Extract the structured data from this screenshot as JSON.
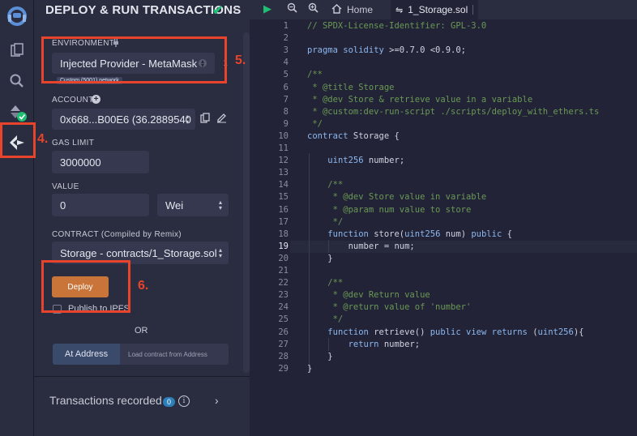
{
  "panel": {
    "title": "DEPLOY & RUN TRANSACTIONS",
    "environment": {
      "label": "ENVIRONMENT",
      "value": "Injected Provider - MetaMask",
      "network_tooltip": "Custom (5001) network"
    },
    "account": {
      "label": "ACCOUNT",
      "value": "0x668...B00E6 (36.2889540"
    },
    "gas_limit": {
      "label": "GAS LIMIT",
      "value": "3000000"
    },
    "value": {
      "label": "VALUE",
      "amount": "0",
      "unit": "Wei"
    },
    "contract": {
      "label": "CONTRACT (Compiled by Remix)",
      "value": "Storage - contracts/1_Storage.sol"
    },
    "deploy_label": "Deploy",
    "publish_label": "Publish to IPFS",
    "publish_checked": false,
    "or_label": "OR",
    "at_address_label": "At Address",
    "load_contract_placeholder": "Load contract from Address",
    "transactions_label": "Transactions recorded",
    "transactions_count": "0"
  },
  "annotations": {
    "step4": "4.",
    "step5": "5.",
    "step6": "6."
  },
  "tabs": {
    "home": "Home",
    "file": "1_Storage.sol"
  },
  "editor": {
    "current_line": 19,
    "lines": [
      {
        "n": "1",
        "c": "// SPDX-License-Identifier: GPL-3.0"
      },
      {
        "n": "2",
        "c": ""
      },
      {
        "n": "3",
        "c": "pragma solidity >=0.7.0 <0.9.0;"
      },
      {
        "n": "4",
        "c": ""
      },
      {
        "n": "5",
        "c": "/**"
      },
      {
        "n": "6",
        "c": " * @title Storage"
      },
      {
        "n": "7",
        "c": " * @dev Store & retrieve value in a variable"
      },
      {
        "n": "8",
        "c": " * @custom:dev-run-script ./scripts/deploy_with_ethers.ts"
      },
      {
        "n": "9",
        "c": " */"
      },
      {
        "n": "10",
        "c": "contract Storage {"
      },
      {
        "n": "11",
        "c": ""
      },
      {
        "n": "12",
        "c": "    uint256 number;"
      },
      {
        "n": "13",
        "c": ""
      },
      {
        "n": "14",
        "c": "    /**"
      },
      {
        "n": "15",
        "c": "     * @dev Store value in variable"
      },
      {
        "n": "16",
        "c": "     * @param num value to store"
      },
      {
        "n": "17",
        "c": "     */"
      },
      {
        "n": "18",
        "c": "    function store(uint256 num) public {"
      },
      {
        "n": "19",
        "c": "        number = num;"
      },
      {
        "n": "20",
        "c": "    }"
      },
      {
        "n": "21",
        "c": ""
      },
      {
        "n": "22",
        "c": "    /**"
      },
      {
        "n": "23",
        "c": "     * @dev Return value"
      },
      {
        "n": "24",
        "c": "     * @return value of 'number'"
      },
      {
        "n": "25",
        "c": "     */"
      },
      {
        "n": "26",
        "c": "    function retrieve() public view returns (uint256){"
      },
      {
        "n": "27",
        "c": "        return number;"
      },
      {
        "n": "28",
        "c": "    }"
      },
      {
        "n": "29",
        "c": "}"
      }
    ]
  },
  "colors": {
    "accent": "#c97539",
    "annotation": "#e8442c",
    "check": "#1fbf73",
    "comment": "#6a9955",
    "keyword": "#8db8ef"
  },
  "icons": [
    "remix-logo-icon",
    "file-explorer-icon",
    "search-icon",
    "solidity-compiler-icon",
    "deploy-run-icon",
    "plug-icon",
    "plus-circle-icon",
    "copy-icon",
    "edit-icon",
    "play-icon",
    "zoom-out-icon",
    "zoom-in-icon",
    "home-icon",
    "file-icon",
    "info-icon",
    "chevron-right-icon"
  ]
}
